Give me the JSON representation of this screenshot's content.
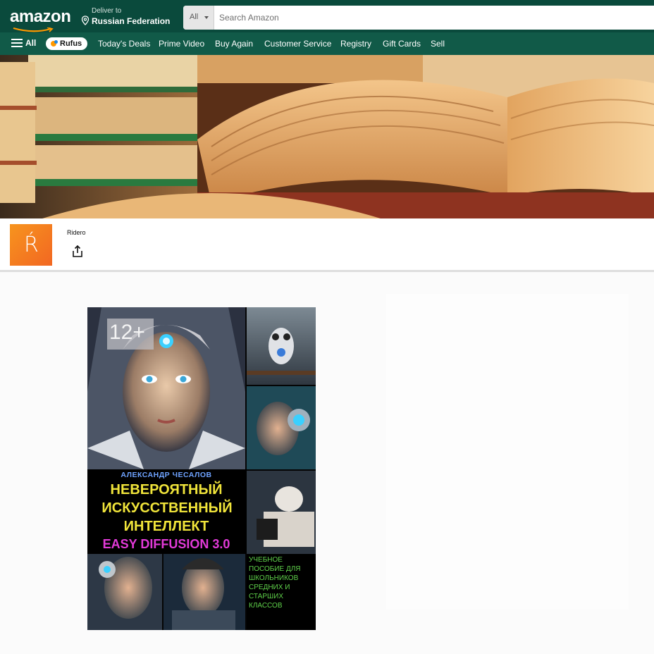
{
  "header": {
    "logo": "amazon",
    "deliver_line1": "Deliver to",
    "deliver_line2": "Russian Federation",
    "search_category": "All",
    "search_placeholder": "Search Amazon"
  },
  "nav": {
    "all_label": "All",
    "rufus_label": "Rufus",
    "links": [
      "Today's Deals",
      "Prime Video",
      "Buy Again",
      "Customer Service",
      "Registry",
      "Gift Cards",
      "Sell"
    ]
  },
  "brand": {
    "logo_letter": "Ŕ",
    "name": "Ridero"
  },
  "book": {
    "age_rating": "12+",
    "author": "АЛЕКСАНДР ЧЕСАЛОВ",
    "title_line1": "НЕВЕРОЯТНЫЙ",
    "title_line2": "ИСКУССТВЕННЫЙ",
    "title_line3": "ИНТЕЛЛЕКТ",
    "subtitle": "EASY DIFFUSION 3.0",
    "blurb_lines": [
      "УЧЕБНОЕ",
      "ПОСОБИЕ ДЛЯ",
      "ШКОЛЬНИКОВ",
      "СРЕДНИХ И",
      "СТАРШИХ",
      "КЛАССОВ"
    ]
  },
  "colors": {
    "header_bg": "#0a4a3c",
    "nav_bg": "#115a48",
    "brand_orange": "#f26722",
    "title_yellow": "#f0e43a",
    "subtitle_magenta": "#e23ad8",
    "blurb_green": "#5fd14a",
    "author_blue": "#6fa3ff"
  }
}
